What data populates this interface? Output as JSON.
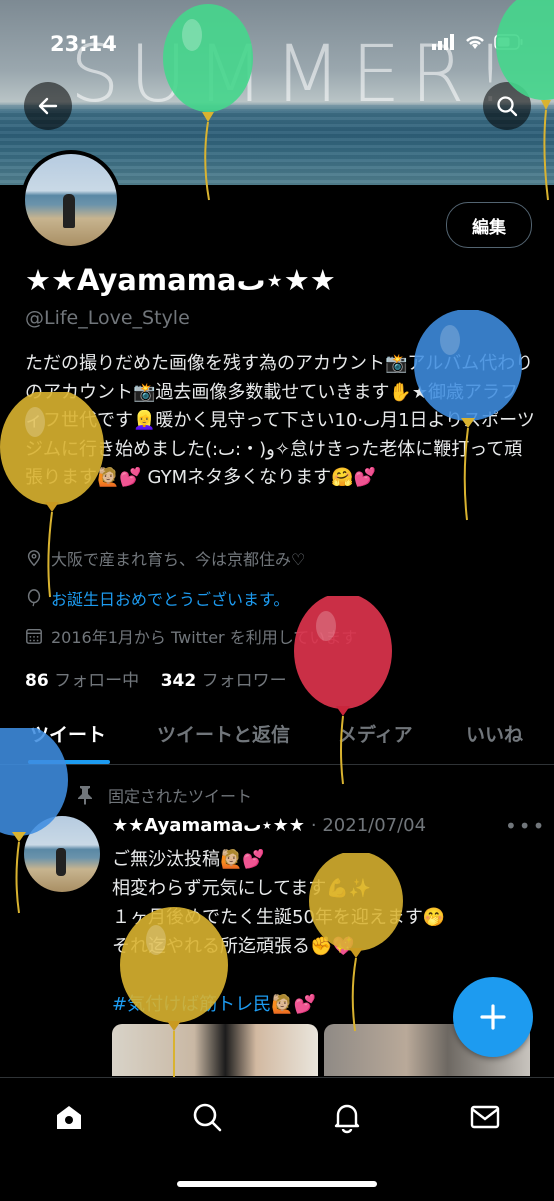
{
  "status": {
    "time": "23:14"
  },
  "banner": {
    "text": "SUMMER!"
  },
  "profile": {
    "edit_label": "編集",
    "name": "★★Ayamamaٮ⋆★★",
    "handle": "@Life_Love_Style",
    "bio": "ただの撮りだめた画像を残す為のアカウント📸アルバム代わりのアカウント📸過去画像多数載せていきます✋★御歳アラフィフ世代です👱‍♀️暖かく見守って下さいٮ·10月1日よりスポーツジムに行き始めました(:ٮ:・)و✧怠けきった老体に鞭打って頑張ります🙋🏼💕 GYMネタ多くなります🤗💕",
    "location": "大阪で産まれ育ち、今は京都住み♡",
    "birthday": "お誕生日おめでとうございます。",
    "joined": "2016年1月から Twitter を利用しています",
    "following_count": "86",
    "following_label": "フォロー中",
    "followers_count": "342",
    "followers_label": "フォロワー"
  },
  "tabs": [
    "ツイート",
    "ツイートと返信",
    "メディア",
    "いいね"
  ],
  "tweet": {
    "pinned_label": "固定されたツイート",
    "author": "★★Ayamamaٮ⋆★★",
    "date": "· 2021/07/04",
    "line1": "ご無沙汰投稿🙋🏼💕",
    "line2": "相変わらず元気にしてます💪✨",
    "line3": "１ヶ月後めでたく生誕50年を迎えます🤭",
    "line4": "それ迄やれる所迄頑張る✊💖",
    "hashtag": "#気付けば筋トレ民🙋🏼💕"
  },
  "colors": {
    "accent": "#1d9bf0",
    "background": "#000000",
    "muted": "#71767b"
  },
  "icons": [
    "back-arrow-icon",
    "search-icon",
    "location-icon",
    "balloon-icon",
    "calendar-icon",
    "pin-icon",
    "more-icon",
    "compose-icon",
    "home-icon",
    "explore-icon",
    "notifications-icon",
    "messages-icon"
  ]
}
